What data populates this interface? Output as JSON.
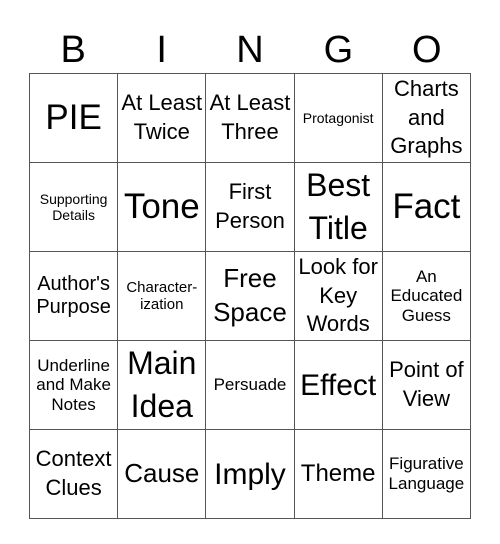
{
  "header": [
    "B",
    "I",
    "N",
    "G",
    "O"
  ],
  "rows": [
    [
      "PIE",
      "At Least Twice",
      "At Least Three",
      "Protagonist",
      "Charts and Graphs"
    ],
    [
      "Supporting Details",
      "Tone",
      "First Person",
      "Best Title",
      "Fact"
    ],
    [
      "Author's Purpose",
      "Character-ization",
      "Free Space",
      "Look for Key Words",
      "An Educated Guess"
    ],
    [
      "Underline and Make Notes",
      "Main Idea",
      "Persuade",
      "Effect",
      "Point of View"
    ],
    [
      "Context Clues",
      "Cause",
      "Imply",
      "Theme",
      "Figurative Language"
    ]
  ]
}
